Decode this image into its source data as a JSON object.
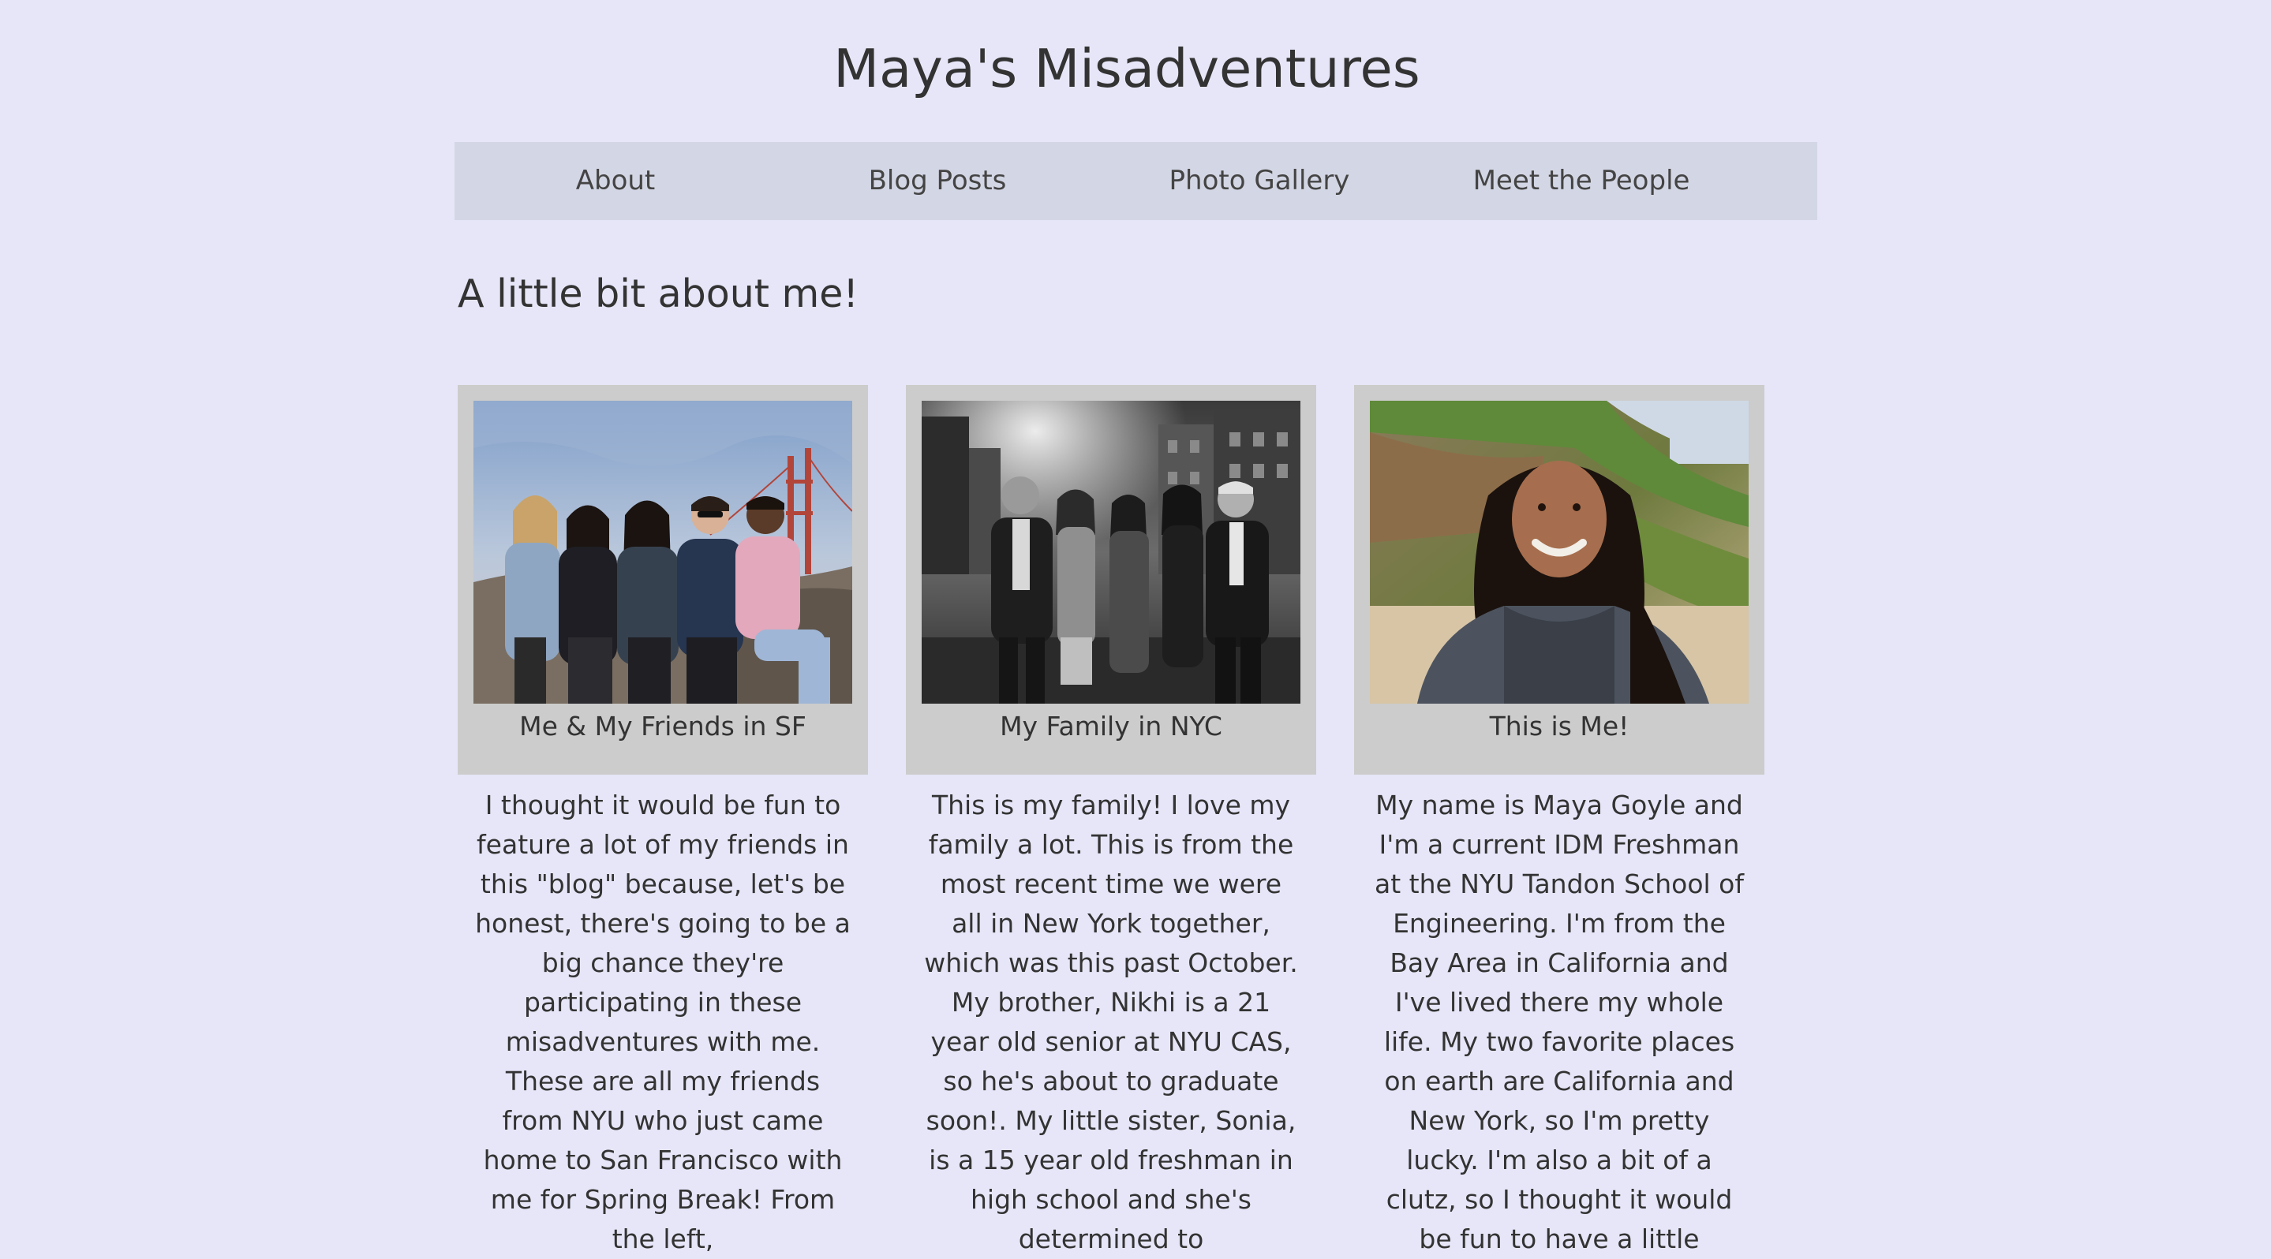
{
  "site": {
    "title": "Maya's Misadventures"
  },
  "nav": {
    "items": [
      {
        "label": "About"
      },
      {
        "label": "Blog Posts"
      },
      {
        "label": "Photo Gallery"
      },
      {
        "label": "Meet the People"
      }
    ]
  },
  "main": {
    "heading": "A little bit about me!",
    "cards": [
      {
        "caption": "Me & My Friends in SF",
        "text": "I thought it would be fun to feature a lot of my friends in this \"blog\" because, let's be honest, there's going to be a big chance they're participating in these misadventures with me. These are all my friends from NYU who just came home to San Francisco with me for Spring Break! From the left,"
      },
      {
        "caption": "My Family in NYC",
        "text": "This is my family! I love my family a lot. This is from the most recent time we were all in New York together, which was this past October. My brother, Nikhi is a 21 year old senior at NYU CAS, so he's about to graduate soon!. My little sister, Sonia, is a 15 year old freshman in high school and she's determined to"
      },
      {
        "caption": "This is Me!",
        "text": "My name is Maya Goyle and I'm a current IDM Freshman at the NYU Tandon School of Engineering. I'm from the Bay Area in California and I've lived there my whole life. My two favorite places on earth are California and New York, so I'm pretty lucky. I'm also a bit of a clutz, so I thought it would be fun to have a little"
      }
    ]
  },
  "colors": {
    "background": "#e6e6f8",
    "nav_background": "#d3d6e4",
    "card_frame": "#cccccc",
    "text": "#333333"
  }
}
